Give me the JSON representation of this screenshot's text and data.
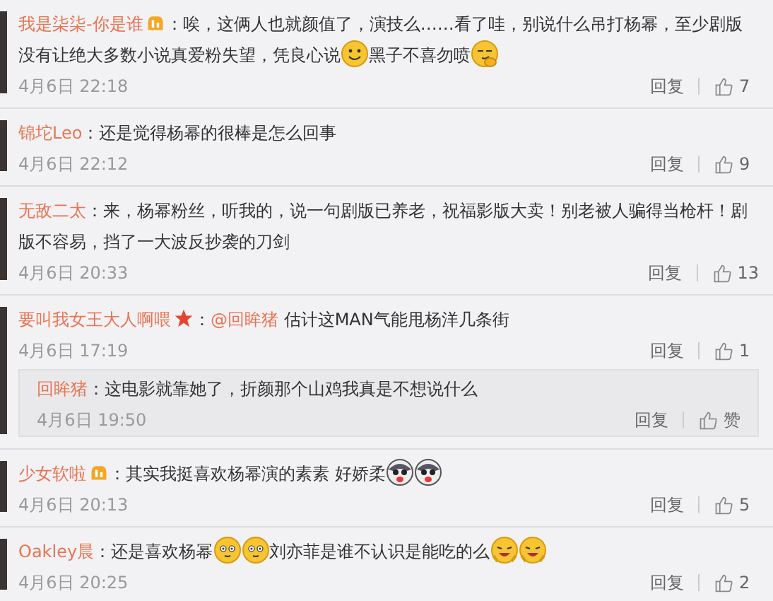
{
  "comments": [
    {
      "user": "我是柒柒-你是谁",
      "badge": {
        "kind": "vip"
      },
      "content": [
        {
          "kind": "text",
          "text": "：唉，这俩人也就颜值了，演技么……看了哇，别说什么吊打杨幂，至少剧版没有让绝大多数小说真爱粉失望，凭良心说"
        },
        {
          "kind": "smile"
        },
        {
          "kind": "text",
          "text": "黑子不喜勿喷"
        },
        {
          "kind": "smirk"
        }
      ],
      "time": "4月6日 22:18",
      "reply_label": "回复",
      "likes": "7"
    },
    {
      "user": "锦坨Leo",
      "content": [
        {
          "kind": "text",
          "text": "：还是觉得杨幂的很棒是怎么回事"
        }
      ],
      "time": "4月6日 22:12",
      "reply_label": "回复",
      "likes": "9"
    },
    {
      "user": "无敌二太",
      "content": [
        {
          "kind": "text",
          "text": "：来，杨幂粉丝，听我的，说一句剧版已养老，祝福影版大卖！别老被人骗得当枪杆！剧版不容易，挡了一大波反抄袭的刀剑"
        }
      ],
      "time": "4月6日 20:33",
      "reply_label": "回复",
      "likes": "13"
    },
    {
      "user": "要叫我女王大人啊喂",
      "badge": {
        "kind": "star"
      },
      "content": [
        {
          "kind": "text",
          "text": "："
        },
        {
          "kind": "mention",
          "text": "@回眸猪"
        },
        {
          "kind": "text",
          "text": " 估计这MAN气能甩杨洋几条街"
        }
      ],
      "time": "4月6日 17:19",
      "reply_label": "回复",
      "likes": "1",
      "replies": [
        {
          "user": "回眸猪",
          "content": [
            {
              "kind": "text",
              "text": "：这电影就靠她了，折颜那个山鸡我真是不想说什么"
            }
          ],
          "time": "4月6日 19:50",
          "reply_label": "回复",
          "likes": "赞"
        }
      ]
    },
    {
      "user": "少女软啦",
      "badge": {
        "kind": "vip"
      },
      "content": [
        {
          "kind": "text",
          "text": "：其实我挺喜欢杨幂演的素素 好娇柔"
        },
        {
          "kind": "dog"
        },
        {
          "kind": "dog"
        }
      ],
      "time": "4月6日 20:13",
      "reply_label": "回复",
      "likes": "5"
    },
    {
      "user": "Oakley晨",
      "content": [
        {
          "kind": "text",
          "text": "：还是喜欢杨幂"
        },
        {
          "kind": "blush"
        },
        {
          "kind": "blush"
        },
        {
          "kind": "text",
          "text": "刘亦菲是谁不认识是能吃的么"
        },
        {
          "kind": "laugh"
        },
        {
          "kind": "laugh"
        }
      ],
      "time": "4月6日 20:25",
      "reply_label": "回复",
      "likes": "2"
    }
  ]
}
